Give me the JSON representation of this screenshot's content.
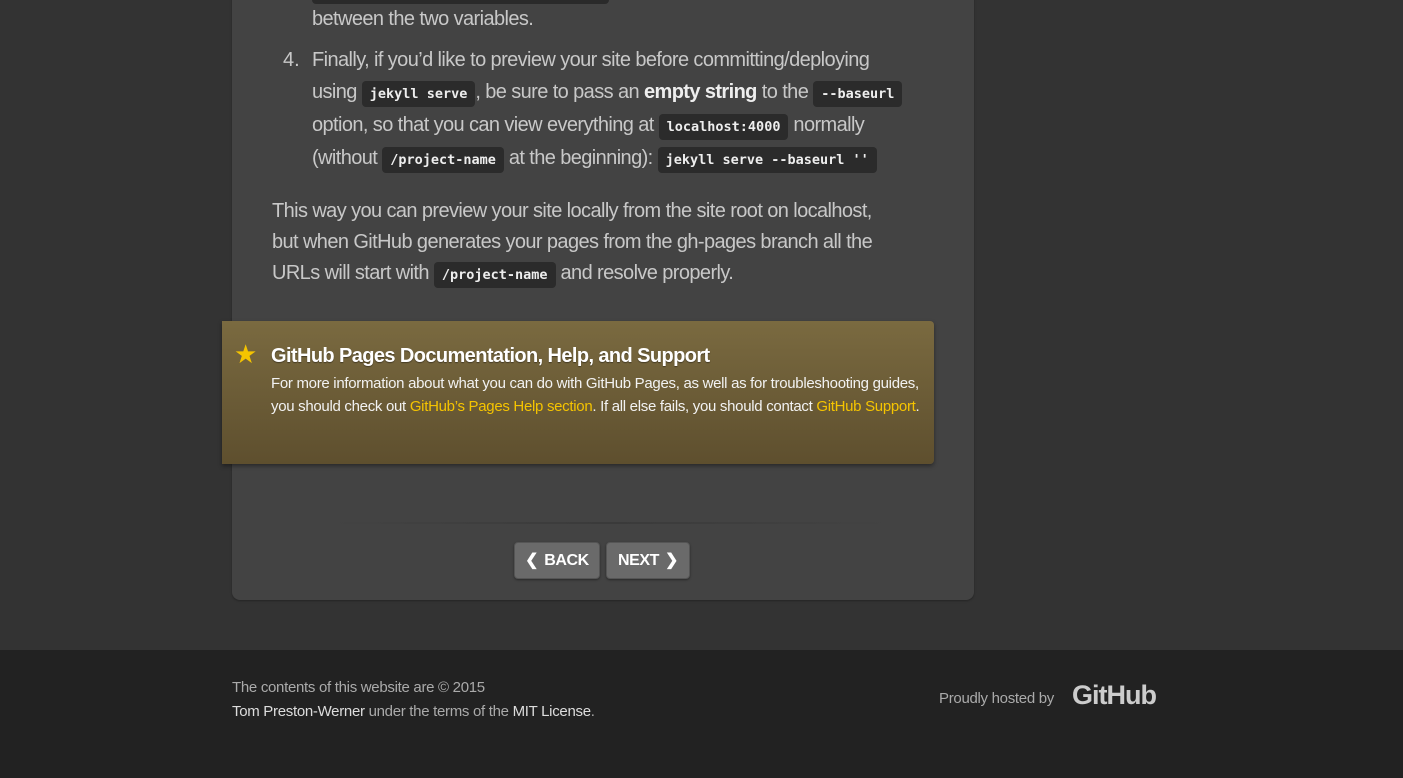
{
  "content": {
    "prev_line_end": "between the two variables.",
    "item4": {
      "number": "4.",
      "l1": "Finally, if you’d like to preview your site before committing/deploying",
      "l2a": "using",
      "code1": "jekyll serve",
      "l2b": ", be sure to pass an",
      "bold": "empty string",
      "l2c": "to the",
      "code2": "--baseurl",
      "l3a": "option, so that you can view everything at",
      "code3": "localhost:4000",
      "l3b": "normally",
      "l4a": "(without",
      "code4": "/project-name",
      "l4b": "at the beginning):",
      "code5": "jekyll serve --baseurl ''"
    },
    "para": {
      "l1": "This way you can preview your site locally from the site root on localhost,",
      "l2": "but when GitHub generates your pages from the gh-pages branch all the",
      "l3a": "URLs will start with",
      "code": "/project-name",
      "l3b": "and resolve properly."
    }
  },
  "callout": {
    "icon": "star-icon",
    "title": "GitHub Pages Documentation, Help, and Support",
    "t1": "For more information about what you can do with GitHub Pages, as well as for troubleshooting guides, you should check out",
    "link1": "GitHub’s Pages Help section",
    "t2": ". If all else fails, you should contact",
    "link2": "GitHub Support",
    "t3": "."
  },
  "nav": {
    "back": "BACK",
    "next": "NEXT"
  },
  "footer": {
    "t1": "The contents of this website are © 2015",
    "author": "Tom Preston-Werner",
    "t2": "under the terms of the",
    "license": "MIT License",
    "t3": ".",
    "hosted": "Proudly hosted by",
    "logo": "GitHub"
  },
  "colors": {
    "accent": "#f5c400",
    "callout_bg": "#6e5f38",
    "card_bg": "#434343",
    "footer_bg": "#222222"
  }
}
